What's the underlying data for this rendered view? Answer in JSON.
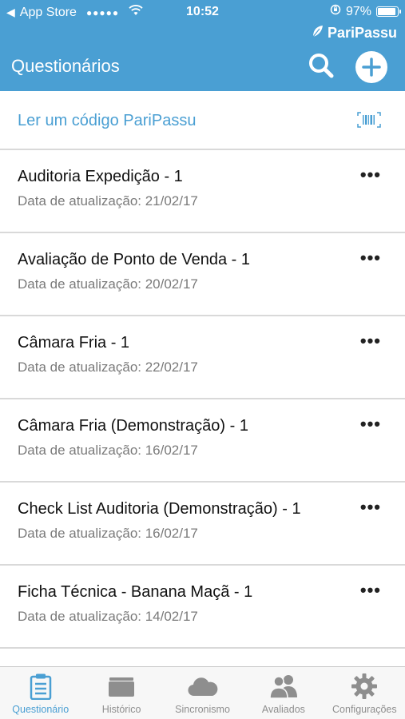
{
  "status_bar": {
    "back_app": "App Store",
    "signal": "●●●●●",
    "time": "10:52",
    "battery": "97%",
    "battery_level": 0.97
  },
  "header": {
    "brand": "PariPassu",
    "title": "Questionários"
  },
  "scan": {
    "label": "Ler um código PariPassu"
  },
  "items": [
    {
      "title": "Auditoria Expedição - 1",
      "date": "Data de atualização: 21/02/17"
    },
    {
      "title": "Avaliação de Ponto de Venda - 1",
      "date": "Data de atualização: 20/02/17"
    },
    {
      "title": "Câmara Fria - 1",
      "date": "Data de atualização: 22/02/17"
    },
    {
      "title": "Câmara Fria (Demonstração) - 1",
      "date": "Data de atualização: 16/02/17"
    },
    {
      "title": "Check List Auditoria (Demonstração) - 1",
      "date": "Data de atualização: 16/02/17"
    },
    {
      "title": "Ficha Técnica - Banana Maçã - 1",
      "date": "Data de atualização: 14/02/17"
    }
  ],
  "more_label": "•••",
  "tabs": [
    {
      "label": "Questionário",
      "icon": "clipboard-icon",
      "active": true
    },
    {
      "label": "Histórico",
      "icon": "folder-icon",
      "active": false
    },
    {
      "label": "Sincronismo",
      "icon": "cloud-icon",
      "active": false
    },
    {
      "label": "Avaliados",
      "icon": "people-icon",
      "active": false
    },
    {
      "label": "Configurações",
      "icon": "gear-icon",
      "active": false
    }
  ],
  "colors": {
    "accent": "#4a9fd3",
    "tab_inactive": "#8e8e8e",
    "date_text": "#7a7a7a"
  }
}
